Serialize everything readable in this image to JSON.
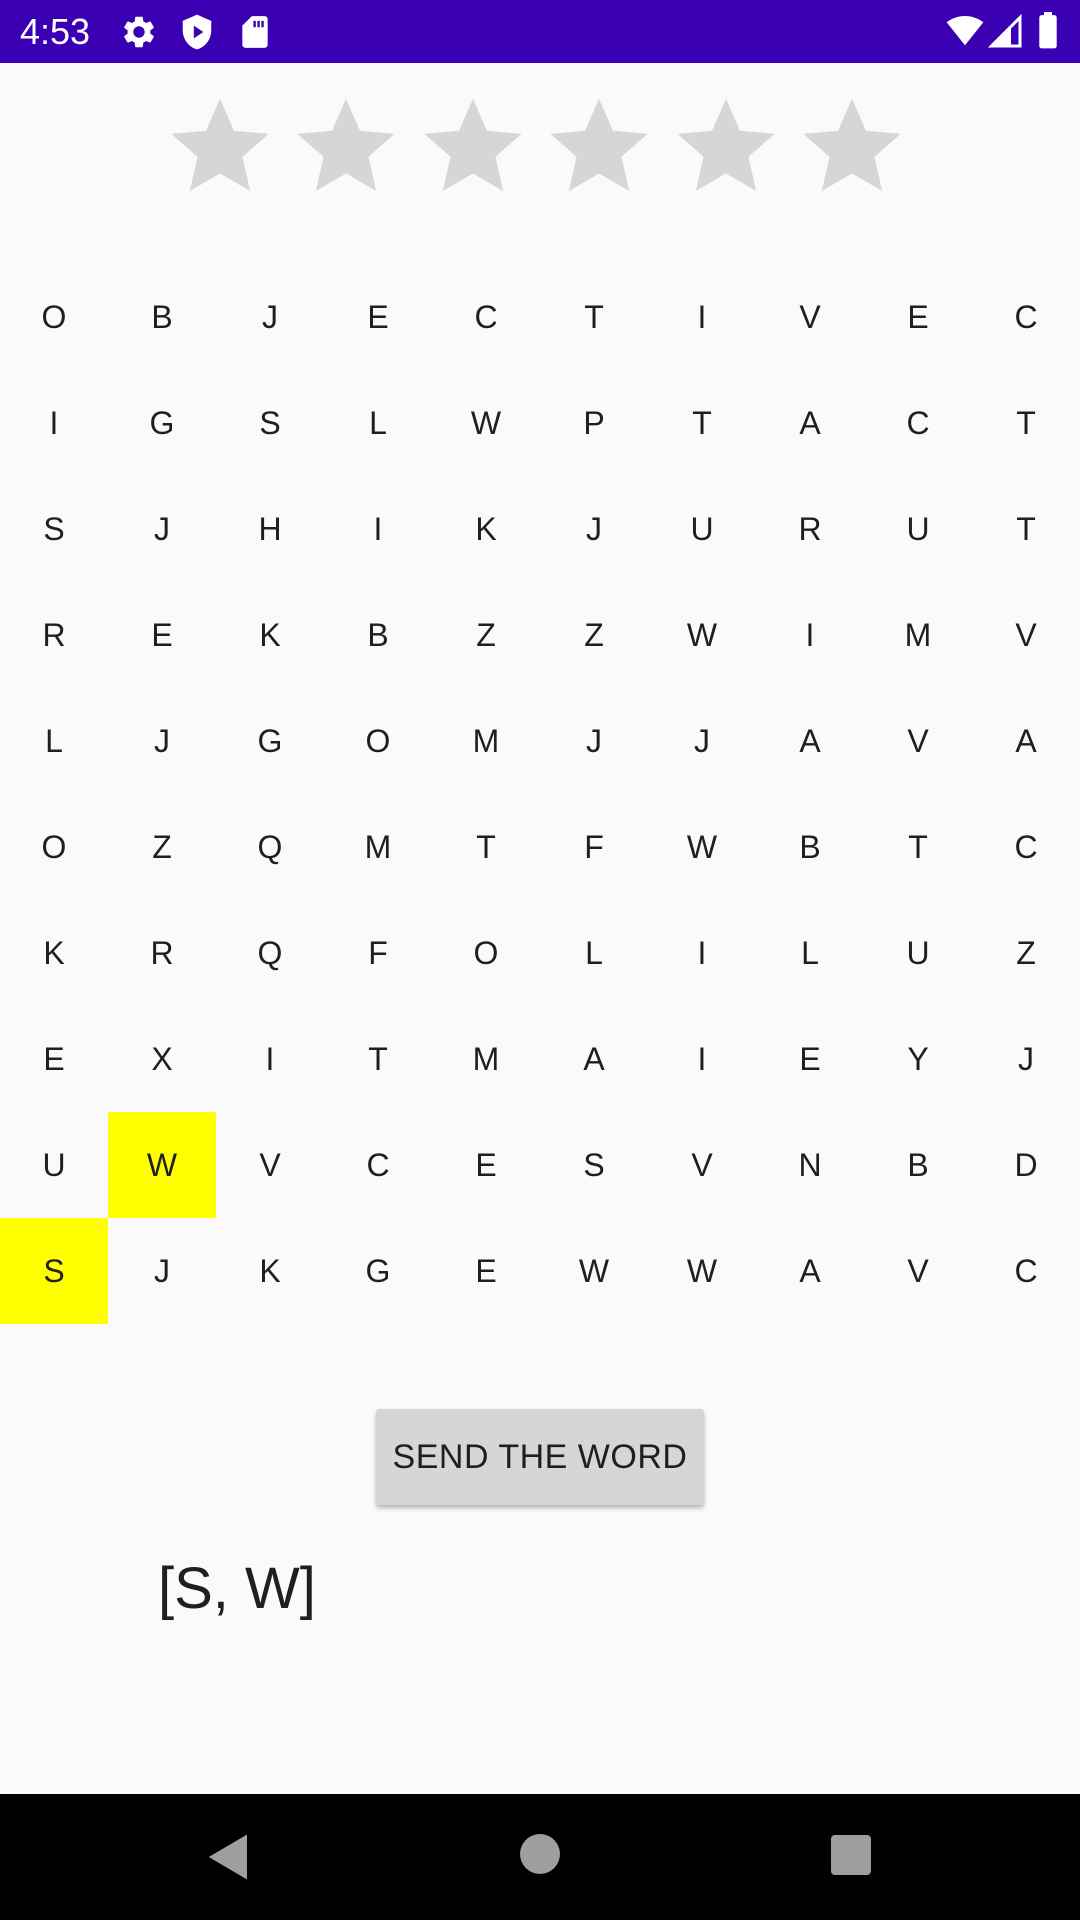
{
  "status_bar": {
    "time": "4:53",
    "background": "#3b00b3",
    "left_icons": [
      "gear-icon",
      "play-protect-icon",
      "sd-card-icon"
    ],
    "right_icons": [
      "wifi-icon",
      "signal-icon",
      "battery-icon"
    ]
  },
  "rating": {
    "total_stars": 6,
    "filled_stars": 0,
    "star_color": "#d6d6d6"
  },
  "grid": {
    "rows": [
      [
        "O",
        "B",
        "J",
        "E",
        "C",
        "T",
        "I",
        "V",
        "E",
        "C"
      ],
      [
        "I",
        "G",
        "S",
        "L",
        "W",
        "P",
        "T",
        "A",
        "C",
        "T"
      ],
      [
        "S",
        "J",
        "H",
        "I",
        "K",
        "J",
        "U",
        "R",
        "U",
        "T"
      ],
      [
        "R",
        "E",
        "K",
        "B",
        "Z",
        "Z",
        "W",
        "I",
        "M",
        "V"
      ],
      [
        "L",
        "J",
        "G",
        "O",
        "M",
        "J",
        "J",
        "A",
        "V",
        "A"
      ],
      [
        "O",
        "Z",
        "Q",
        "M",
        "T",
        "F",
        "W",
        "B",
        "T",
        "C"
      ],
      [
        "K",
        "R",
        "Q",
        "F",
        "O",
        "L",
        "I",
        "L",
        "U",
        "Z"
      ],
      [
        "E",
        "X",
        "I",
        "T",
        "M",
        "A",
        "I",
        "E",
        "Y",
        "J"
      ],
      [
        "U",
        "W",
        "V",
        "C",
        "E",
        "S",
        "V",
        "N",
        "B",
        "D"
      ],
      [
        "S",
        "J",
        "K",
        "G",
        "E",
        "W",
        "W",
        "A",
        "V",
        "C"
      ]
    ],
    "selected_cells": [
      [
        8,
        1
      ],
      [
        9,
        0
      ]
    ],
    "highlight_color": "#ffff00"
  },
  "send_button": {
    "label": "SEND THE WORD"
  },
  "selected_word": "[S, W]",
  "nav_bar": {
    "buttons": [
      "back-icon",
      "home-icon",
      "recents-icon"
    ]
  }
}
